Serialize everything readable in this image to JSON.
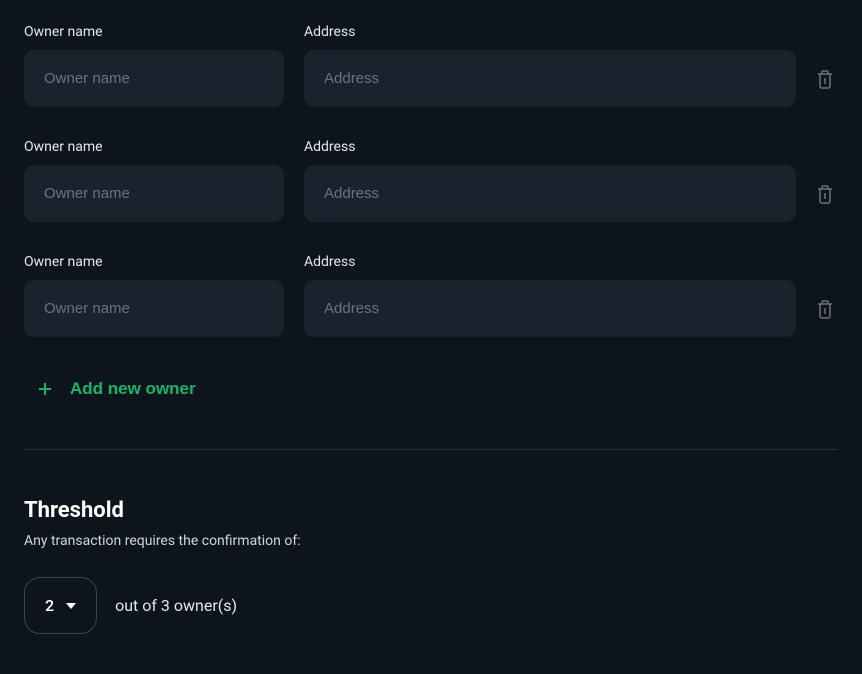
{
  "owners": [
    {
      "name_label": "Owner name",
      "name_placeholder": "Owner name",
      "name_value": "",
      "address_label": "Address",
      "address_placeholder": "Address",
      "address_value": ""
    },
    {
      "name_label": "Owner name",
      "name_placeholder": "Owner name",
      "name_value": "",
      "address_label": "Address",
      "address_placeholder": "Address",
      "address_value": ""
    },
    {
      "name_label": "Owner name",
      "name_placeholder": "Owner name",
      "name_value": "",
      "address_label": "Address",
      "address_placeholder": "Address",
      "address_value": ""
    }
  ],
  "add_owner_label": "Add new owner",
  "threshold": {
    "title": "Threshold",
    "description": "Any transaction requires the confirmation of:",
    "selected": "2",
    "suffix": "out of 3 owner(s)"
  }
}
